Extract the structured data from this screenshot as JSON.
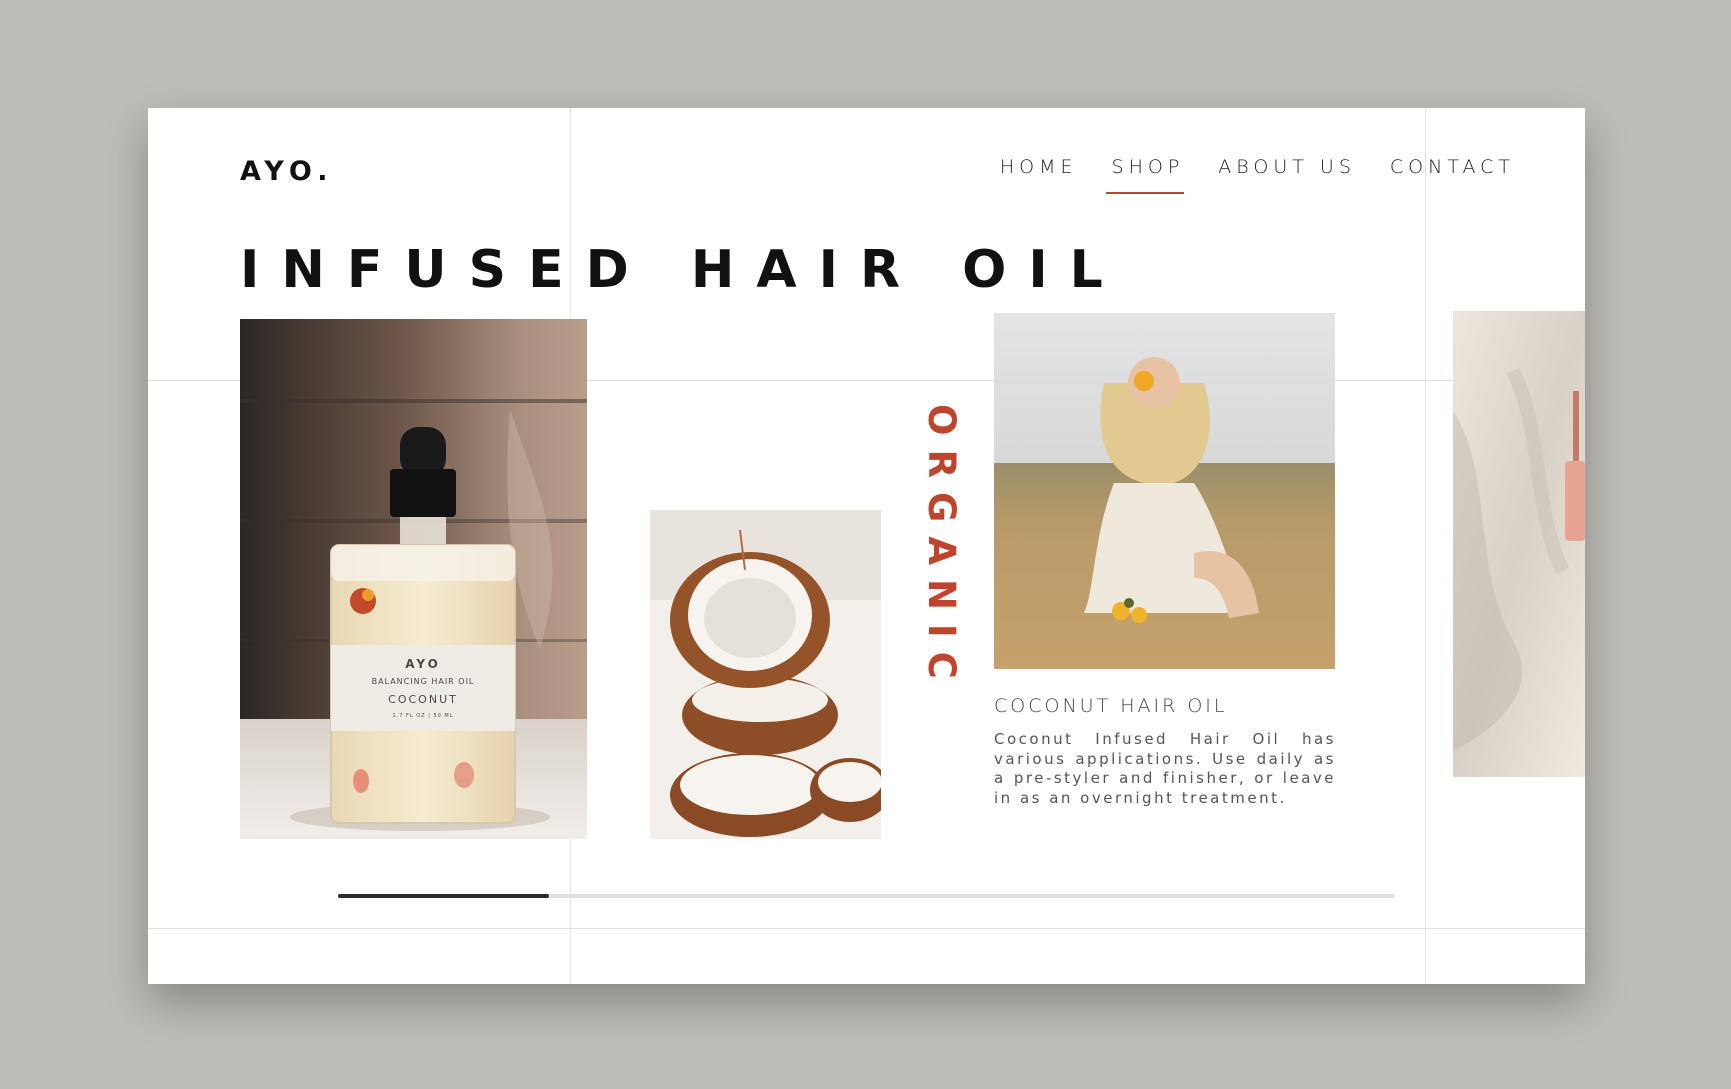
{
  "brand": {
    "logo": "AYO."
  },
  "nav": [
    {
      "label": "HOME",
      "active": false
    },
    {
      "label": "SHOP",
      "active": true
    },
    {
      "label": "ABOUT US",
      "active": false
    },
    {
      "label": "CONTACT",
      "active": false
    }
  ],
  "hero": {
    "title": "INFUSED HAIR OIL",
    "vertical_word": "ORGANIC"
  },
  "bottle_label": {
    "brand": "AYO",
    "line": "BALANCING HAIR OIL",
    "variant": "COCONUT",
    "volume": "1.7 FL OZ | 50 ML"
  },
  "product": {
    "title": "COCONUT HAIR OIL",
    "description": "Coconut Infused Hair Oil has various applications. Use daily as a pre-styler and finisher, or leave in as an overnight treatment."
  },
  "gallery": {
    "scroll_progress": 0.2
  },
  "colors": {
    "accent": "#c0432c",
    "background": "#bdbcb6",
    "card": "#ffffff"
  }
}
